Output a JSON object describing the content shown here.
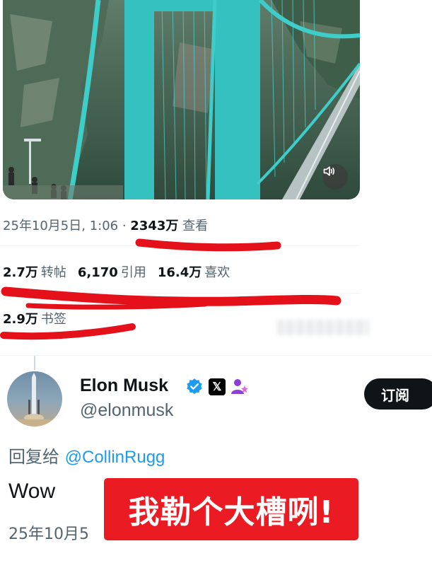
{
  "tweet": {
    "timestamp": "25年10月5日, 1:06",
    "separator": " · ",
    "views_count": "2343万",
    "views_label": "查看",
    "stats": {
      "retweets_count": "2.7万",
      "retweets_label": "转帖",
      "quotes_count": "6,170",
      "quotes_label": "引用",
      "likes_count": "16.4万",
      "likes_label": "喜欢"
    },
    "bookmarks_count": "2.9万",
    "bookmarks_label": "书签"
  },
  "reply": {
    "author_name": "Elon Musk",
    "handle": "@elonmusk",
    "x_badge": "𝕏",
    "subscribe_label": "订阅",
    "reply_to_label": "回复给",
    "reply_to_mention": "@CollinRugg",
    "text": "Wow",
    "timestamp_partial": "25年10月5"
  },
  "overlay_caption": "我勒个大槽咧!",
  "icons": {
    "sound": "speaker-icon",
    "verified": "verified-badge-icon",
    "affiliation": "affiliate-person-icon"
  },
  "colors": {
    "accent_blue": "#1d9bf0",
    "annotation_red": "#e4101a",
    "caption_red": "#ea1b22",
    "bridge_teal": "#35c1c0"
  }
}
